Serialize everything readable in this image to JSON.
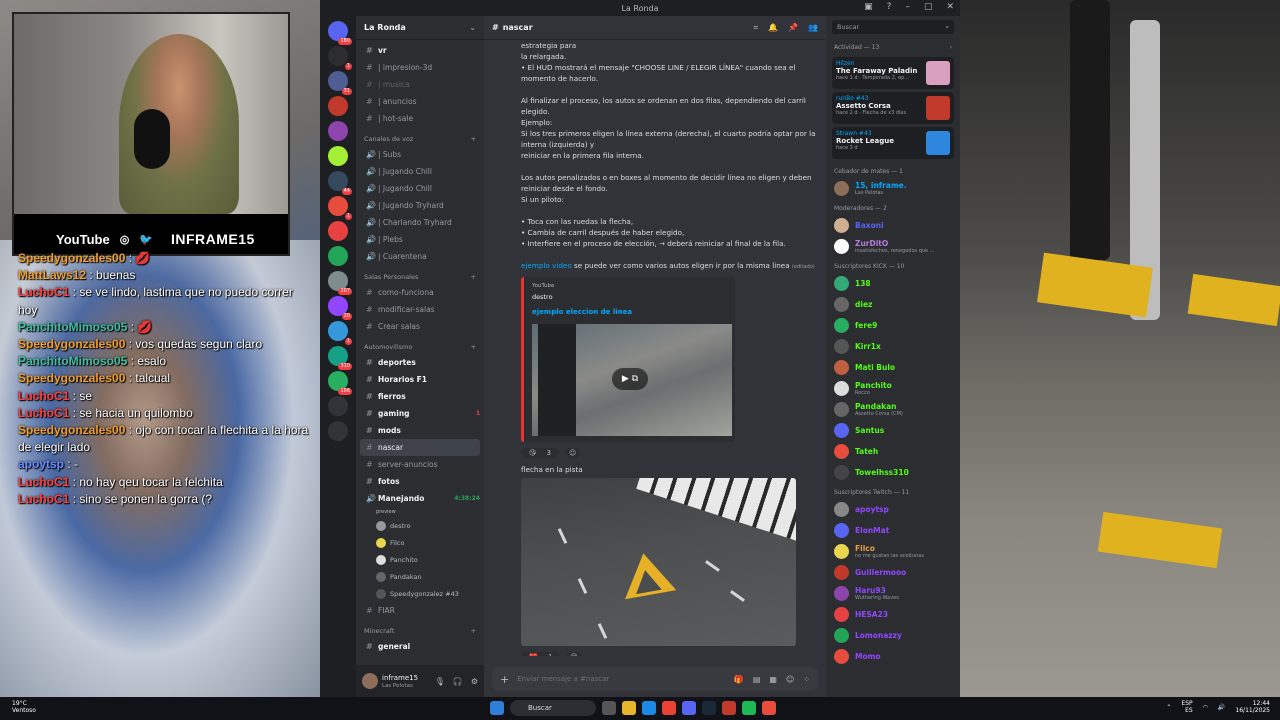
{
  "webcam": {
    "youtube": "YouTube",
    "instagram_icon": "instagram-icon",
    "twitter_icon": "twitter-icon",
    "handle": "INFRAME15"
  },
  "chat": [
    {
      "user": "Speedygonzales00",
      "text": ": 💋",
      "color": "#f0a030"
    },
    {
      "user": "MattLaws12",
      "text": ": buenas",
      "color": "#f0a030"
    },
    {
      "user": "LuchoC1",
      "text": ": se ve lindo, lastima que no puedo correr hoy",
      "color": "#ff4040"
    },
    {
      "user": "PanchitoMimoso05",
      "text": ": 💋",
      "color": "#40c0a0"
    },
    {
      "user": "Speedygonzales00",
      "text": ": vos quedas segun claro",
      "color": "#f0a030"
    },
    {
      "user": "PanchitoMimoso05",
      "text": ": esalo",
      "color": "#40c0a0"
    },
    {
      "user": "Speedygonzales00",
      "text": ": talcual",
      "color": "#f0a030"
    },
    {
      "user": "LuchoC1",
      "text": ": se",
      "color": "#ff4040"
    },
    {
      "user": "LuchoC1",
      "text": ": se hacia un quilombo",
      "color": "#ff4040"
    },
    {
      "user": "Speedygonzales00",
      "text": ": ojo con tocar la flechita a la hora de elegir lado",
      "color": "#f0a030"
    },
    {
      "user": "apoytsp",
      "text": ": -",
      "color": "#6a8cff"
    },
    {
      "user": "LuchoC1",
      "text": ": no hay qeu tocar la felchita",
      "color": "#ff4040"
    },
    {
      "user": "LuchoC1",
      "text": ": sino se ponen la gorra (?",
      "color": "#ff4040"
    }
  ],
  "discord": {
    "title": "La Ronda",
    "titlebar_icons": [
      "inbox-icon",
      "help-icon",
      "minimize-icon",
      "maximize-icon",
      "close-icon"
    ],
    "server_name": "La Ronda",
    "servers": [
      {
        "color": "#5865f2",
        "badge": "180"
      },
      {
        "color": "#2b2d31",
        "badge": "1"
      },
      {
        "color": "#4e5d94",
        "badge": "31"
      },
      {
        "color": "#c0392b",
        "badge": ""
      },
      {
        "color": "#8e44ad",
        "badge": ""
      },
      {
        "color": "#a5ef37",
        "badge": ""
      },
      {
        "color": "#34495e",
        "badge": "44"
      },
      {
        "color": "#e74c3c",
        "badge": "1"
      },
      {
        "color": "#e84141",
        "badge": ""
      },
      {
        "color": "#23a559",
        "badge": ""
      },
      {
        "color": "#7f8c8d",
        "badge": "207"
      },
      {
        "color": "#9147ff",
        "badge": "20"
      },
      {
        "color": "#3498db",
        "badge": "1"
      },
      {
        "color": "#16a085",
        "badge": "310"
      },
      {
        "color": "#27ae60",
        "badge": "106"
      },
      {
        "color": "#313338",
        "badge": ""
      },
      {
        "color": "#313338",
        "badge": ""
      }
    ],
    "channels_top": [
      {
        "name": "vr",
        "state": "bright"
      },
      {
        "name": "| impresion-3d",
        "state": ""
      },
      {
        "name": "| musica",
        "state": "muted"
      },
      {
        "name": "| anuncios",
        "state": ""
      },
      {
        "name": "| hot-sale",
        "state": ""
      }
    ],
    "voice_category": "Canales de voz",
    "voice_channels": [
      "| Subs",
      "| Jugando Chill",
      "| Jugando Chill",
      "| Jugando Tryhard",
      "| Charlando Tryhard",
      "| Plebs",
      "| Cuarentena"
    ],
    "personal_category": "Salas Personales",
    "personal_channels": [
      "como-funciona",
      "modificar-salas",
      "Crear salas"
    ],
    "auto_category": "Automovilismo",
    "auto_channels": [
      {
        "name": "deportes",
        "state": "bright"
      },
      {
        "name": "Horarios F1",
        "state": "bright"
      },
      {
        "name": "fierros",
        "state": "bright"
      },
      {
        "name": "gaming",
        "state": "bright",
        "right": "1"
      },
      {
        "name": "mods",
        "state": "bright"
      },
      {
        "name": "nascar",
        "state": "active"
      },
      {
        "name": "server-anuncios",
        "state": ""
      },
      {
        "name": "fotos",
        "state": "bright"
      }
    ],
    "voice_live": {
      "name": "Manejando",
      "time": "4:38:24",
      "status": "preview"
    },
    "voice_users": [
      {
        "name": "destro",
        "color": "#999"
      },
      {
        "name": "Filco",
        "color": "#e8d44d"
      },
      {
        "name": "Panchito",
        "color": "#ddd"
      },
      {
        "name": "Pandakan",
        "color": "#666"
      },
      {
        "name": "Speedygonzalez #43",
        "color": "#555"
      }
    ],
    "fiar": "FIAR",
    "minecraft_category": "Minecraft",
    "minecraft_channel": "general",
    "user": {
      "name": "inframe15",
      "status": "Las Pelotas"
    },
    "channel_title": "nascar",
    "messages": [
      "estrategia para",
      "la relargada.",
      "• El HUD mostrará el mensaje \"CHOOSE LINE / ELEGIR LÍNEA\" cuando sea el",
      "momento de hacerlo.",
      "",
      "Al finalizar el proceso, los autos se ordenan en dos filas, dependiendo del carril",
      "elegido.",
      "Ejemplo:",
      "Si los tres primeros eligen la línea externa (derecha), el cuarto podría optar por la",
      "interna (izquierda) y",
      "reiniciar en la primera fila interna.",
      "",
      "Los autos penalizados o en boxes al momento de decidir línea no eligen y deben",
      "reiniciar desde el fondo.",
      "Si un piloto:",
      "",
      "• Toca con las ruedas la flecha,",
      "• Cambia de carril después de haber elegido,",
      "• Interfiere en el proceso de elección, → deberá reiniciar al final de la fila."
    ],
    "link_text": "ejemplo video",
    "link_rest": " se puede ver como varios autos eligen ir por la misma linea",
    "link_edited": "(editado)",
    "embed": {
      "provider": "YouTube",
      "author": "destro",
      "title": "ejemplo eleccion de linea"
    },
    "reactions": [
      {
        "emoji": "😘",
        "count": "3"
      }
    ],
    "image_caption": "flecha en la pista",
    "reactions2": [
      {
        "emoji": "❤️",
        "count": "1"
      }
    ],
    "compose_placeholder": "Enviar mensaje a #nascar",
    "search_placeholder": "Buscar",
    "activity_header": "Actividad — 13",
    "activities": [
      {
        "user": "Hilzen",
        "game": "The Faraway Paladin",
        "sub": "hace 1 d · Temporada 2, ep...",
        "color": "#d9a0c0"
      },
      {
        "user": "runBo #43",
        "game": "Assetto Corsa",
        "sub": "hace 2 d · Flecha de x3 días",
        "color": "#c0392b"
      },
      {
        "user": "Strawn #43",
        "game": "Rocket League",
        "sub": "hace 3 d",
        "color": "#2e86de"
      }
    ],
    "groups": [
      {
        "title": "Cebador de mates — 1",
        "members": [
          {
            "name": "15, inframe.",
            "sub": "Las Pelotas",
            "color": "#00a8fc",
            "av": "#8c6e5a"
          }
        ]
      },
      {
        "title": "Moderadores — 2",
        "members": [
          {
            "name": "Baxoni",
            "sub": "",
            "color": "#5865f2",
            "av": "#d0b090"
          },
          {
            "name": "ZurDitO",
            "sub": "insatisfechos, renegados que ...",
            "color": "#b57edc",
            "av": "#fff"
          }
        ]
      },
      {
        "title": "Suscriptores KICK — 10",
        "members": [
          {
            "name": "138",
            "sub": "",
            "color": "#53fc18",
            "av": "#3a7"
          },
          {
            "name": "diez",
            "sub": "",
            "color": "#53fc18",
            "av": "#666"
          },
          {
            "name": "fere9",
            "sub": "",
            "color": "#53fc18",
            "av": "#27ae60"
          },
          {
            "name": "Kirr1x",
            "sub": "",
            "color": "#53fc18",
            "av": "#555"
          },
          {
            "name": "Mati Bulo",
            "sub": "",
            "color": "#53fc18",
            "av": "#c06040"
          },
          {
            "name": "Panchito",
            "sub": "Rocco",
            "color": "#53fc18",
            "av": "#ddd"
          },
          {
            "name": "Pandakan",
            "sub": "Assetto Corsa (CM)",
            "color": "#53fc18",
            "av": "#666"
          },
          {
            "name": "Santus",
            "sub": "",
            "color": "#53fc18",
            "av": "#5865f2"
          },
          {
            "name": "Tateh",
            "sub": "",
            "color": "#53fc18",
            "av": "#e74c3c"
          },
          {
            "name": "Towelhss310",
            "sub": "",
            "color": "#53fc18",
            "av": "#444"
          }
        ]
      },
      {
        "title": "Suscriptores Twitch — 11",
        "members": [
          {
            "name": "apoytsp",
            "sub": "",
            "color": "#9147ff",
            "av": "#888"
          },
          {
            "name": "ElonMat",
            "sub": "",
            "color": "#9147ff",
            "av": "#5865f2"
          },
          {
            "name": "Filco",
            "sub": "no me gustan las aceitunas",
            "color": "#e8a040",
            "av": "#e8d44d"
          },
          {
            "name": "Guillermooo",
            "sub": "",
            "color": "#9147ff",
            "av": "#c0392b"
          },
          {
            "name": "Haru93",
            "sub": "Wuthering Waves",
            "color": "#9147ff",
            "av": "#8e44ad"
          },
          {
            "name": "HESA23",
            "sub": "",
            "color": "#9147ff",
            "av": "#e84141"
          },
          {
            "name": "Lomonazzy",
            "sub": "",
            "color": "#9147ff",
            "av": "#23a559"
          },
          {
            "name": "Momo",
            "sub": "",
            "color": "#9147ff",
            "av": "#e74c3c"
          }
        ]
      }
    ]
  },
  "taskbar": {
    "weather_temp": "19°C",
    "weather_desc": "Ventoso",
    "search": "Buscar",
    "lang": "ESP",
    "lang2": "ES",
    "time": "12:44",
    "date": "16/11/2025"
  }
}
